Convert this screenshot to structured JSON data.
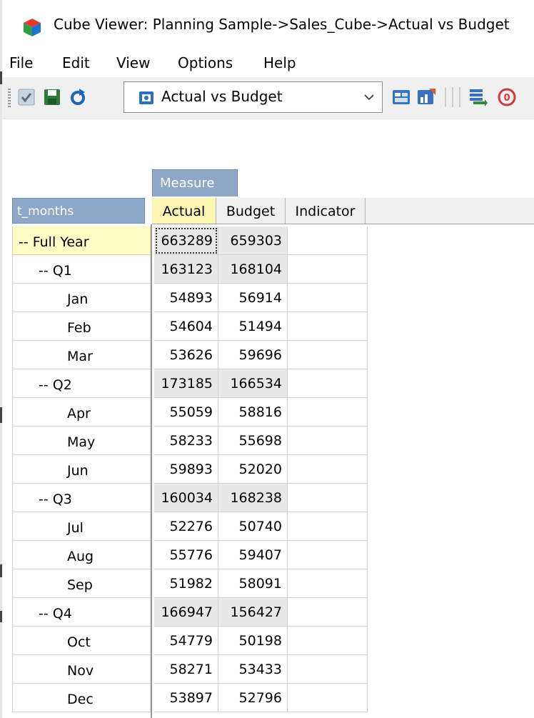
{
  "window": {
    "title": "Cube Viewer: Planning Sample->Sales_Cube->Actual vs Budget"
  },
  "menu": [
    "File",
    "Edit",
    "View",
    "Options",
    "Help"
  ],
  "toolbar": {
    "selected_view": "Actual vs Budget",
    "icons": [
      "grip",
      "commit-check-icon",
      "save-icon",
      "recalculate-icon",
      "view-icon",
      "dropdown-caret-icon",
      "export-icon",
      "chart-icon",
      "column-swap-icon",
      "suppress-zero-icon"
    ]
  },
  "grid": {
    "column_dimension": "Measure",
    "row_dimension": "t_months",
    "columns": [
      "Actual",
      "Budget",
      "Indicator"
    ],
    "rows": [
      {
        "label": "-- Full Year",
        "actual": "663289",
        "budget": "659303",
        "indicator": "",
        "consolidated": true
      },
      {
        "label": "-- Q1",
        "actual": "163123",
        "budget": "168104",
        "indicator": "",
        "consolidated": true
      },
      {
        "label": "Jan",
        "actual": "54893",
        "budget": "56914",
        "indicator": "",
        "consolidated": false
      },
      {
        "label": "Feb",
        "actual": "54604",
        "budget": "51494",
        "indicator": "",
        "consolidated": false
      },
      {
        "label": "Mar",
        "actual": "53626",
        "budget": "59696",
        "indicator": "",
        "consolidated": false
      },
      {
        "label": "-- Q2",
        "actual": "173185",
        "budget": "166534",
        "indicator": "",
        "consolidated": true
      },
      {
        "label": "Apr",
        "actual": "55059",
        "budget": "58816",
        "indicator": "",
        "consolidated": false
      },
      {
        "label": "May",
        "actual": "58233",
        "budget": "55698",
        "indicator": "",
        "consolidated": false
      },
      {
        "label": "Jun",
        "actual": "59893",
        "budget": "52020",
        "indicator": "",
        "consolidated": false
      },
      {
        "label": "-- Q3",
        "actual": "160034",
        "budget": "168238",
        "indicator": "",
        "consolidated": true
      },
      {
        "label": "Jul",
        "actual": "52276",
        "budget": "50740",
        "indicator": "",
        "consolidated": false
      },
      {
        "label": "Aug",
        "actual": "55776",
        "budget": "59407",
        "indicator": "",
        "consolidated": false
      },
      {
        "label": "Sep",
        "actual": "51982",
        "budget": "58091",
        "indicator": "",
        "consolidated": false
      },
      {
        "label": "-- Q4",
        "actual": "166947",
        "budget": "156427",
        "indicator": "",
        "consolidated": true
      },
      {
        "label": "Oct",
        "actual": "54779",
        "budget": "50198",
        "indicator": "",
        "consolidated": false
      },
      {
        "label": "Nov",
        "actual": "58271",
        "budget": "53433",
        "indicator": "",
        "consolidated": false
      },
      {
        "label": "Dec",
        "actual": "53897",
        "budget": "52796",
        "indicator": "",
        "consolidated": false
      }
    ]
  },
  "colors": {
    "header_blue": "#8da7c7",
    "selected_yellow": "#ffffc5",
    "active_column": "#fdf7b3",
    "consolidated_cell": "#e8e8e8"
  }
}
